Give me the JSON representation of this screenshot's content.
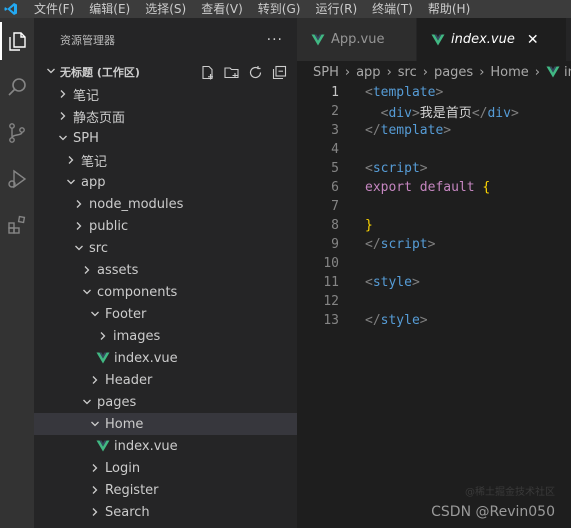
{
  "menu": [
    "文件(F)",
    "编辑(E)",
    "选择(S)",
    "查看(V)",
    "转到(G)",
    "运行(R)",
    "终端(T)",
    "帮助(H)"
  ],
  "explorer": {
    "title": "资源管理器",
    "more": "···",
    "section_title": "无标题 (工作区)"
  },
  "tree": [
    {
      "label": "笔记",
      "depth": 0,
      "chevron": "right",
      "icon": null
    },
    {
      "label": "静态页面",
      "depth": 0,
      "chevron": "right",
      "icon": null
    },
    {
      "label": "SPH",
      "depth": 0,
      "chevron": "down",
      "icon": null
    },
    {
      "label": "笔记",
      "depth": 1,
      "chevron": "right",
      "icon": null
    },
    {
      "label": "app",
      "depth": 1,
      "chevron": "down",
      "icon": null
    },
    {
      "label": "node_modules",
      "depth": 2,
      "chevron": "right",
      "icon": null
    },
    {
      "label": "public",
      "depth": 2,
      "chevron": "right",
      "icon": null
    },
    {
      "label": "src",
      "depth": 2,
      "chevron": "down",
      "icon": null
    },
    {
      "label": "assets",
      "depth": 3,
      "chevron": "right",
      "icon": null
    },
    {
      "label": "components",
      "depth": 3,
      "chevron": "down",
      "icon": null
    },
    {
      "label": "Footer",
      "depth": 4,
      "chevron": "down",
      "icon": null
    },
    {
      "label": "images",
      "depth": 5,
      "chevron": "right",
      "icon": null
    },
    {
      "label": "index.vue",
      "depth": 5,
      "chevron": null,
      "icon": "vue-file-icon"
    },
    {
      "label": "Header",
      "depth": 4,
      "chevron": "right",
      "icon": null
    },
    {
      "label": "pages",
      "depth": 3,
      "chevron": "down",
      "icon": null
    },
    {
      "label": "Home",
      "depth": 4,
      "chevron": "down",
      "icon": null,
      "selected": true
    },
    {
      "label": "index.vue",
      "depth": 5,
      "chevron": null,
      "icon": "vue-file-icon"
    },
    {
      "label": "Login",
      "depth": 4,
      "chevron": "right",
      "icon": null
    },
    {
      "label": "Register",
      "depth": 4,
      "chevron": "right",
      "icon": null
    },
    {
      "label": "Search",
      "depth": 4,
      "chevron": "right",
      "icon": null
    }
  ],
  "tabs": [
    {
      "label": "App.vue",
      "active": false
    },
    {
      "label": "index.vue",
      "active": true,
      "close": "✕"
    }
  ],
  "breadcrumb": [
    "SPH",
    "app",
    "src",
    "pages",
    "Home",
    "inde"
  ],
  "code": {
    "current_line": 1,
    "lines": [
      [
        {
          "t": "<",
          "c": "t-punc"
        },
        {
          "t": "template",
          "c": "t-tag"
        },
        {
          "t": ">",
          "c": "t-punc"
        }
      ],
      [
        {
          "t": "  ",
          "c": "t-text"
        },
        {
          "t": "<",
          "c": "t-punc"
        },
        {
          "t": "div",
          "c": "t-tag"
        },
        {
          "t": ">",
          "c": "t-punc"
        },
        {
          "t": "我是首页",
          "c": "t-text"
        },
        {
          "t": "</",
          "c": "t-punc"
        },
        {
          "t": "div",
          "c": "t-tag"
        },
        {
          "t": ">",
          "c": "t-punc"
        }
      ],
      [
        {
          "t": "</",
          "c": "t-punc"
        },
        {
          "t": "template",
          "c": "t-tag"
        },
        {
          "t": ">",
          "c": "t-punc"
        }
      ],
      [],
      [
        {
          "t": "<",
          "c": "t-punc"
        },
        {
          "t": "script",
          "c": "t-tag"
        },
        {
          "t": ">",
          "c": "t-punc"
        }
      ],
      [
        {
          "t": "export",
          "c": "t-kw"
        },
        {
          "t": " ",
          "c": "t-text"
        },
        {
          "t": "default",
          "c": "t-kw"
        },
        {
          "t": " ",
          "c": "t-text"
        },
        {
          "t": "{",
          "c": "t-brace"
        }
      ],
      [],
      [
        {
          "t": "}",
          "c": "t-brace"
        }
      ],
      [
        {
          "t": "</",
          "c": "t-punc"
        },
        {
          "t": "script",
          "c": "t-tag"
        },
        {
          "t": ">",
          "c": "t-punc"
        }
      ],
      [],
      [
        {
          "t": "<",
          "c": "t-punc"
        },
        {
          "t": "style",
          "c": "t-tag"
        },
        {
          "t": ">",
          "c": "t-punc"
        }
      ],
      [],
      [
        {
          "t": "</",
          "c": "t-punc"
        },
        {
          "t": "style",
          "c": "t-tag"
        },
        {
          "t": ">",
          "c": "t-punc"
        }
      ]
    ]
  },
  "watermark": "CSDN @Revin050",
  "watermark_faint": "@稀土掘金技术社区",
  "colors": {
    "vue_green": "#41b883",
    "vue_dark": "#35495e",
    "accent": "#007acc"
  }
}
